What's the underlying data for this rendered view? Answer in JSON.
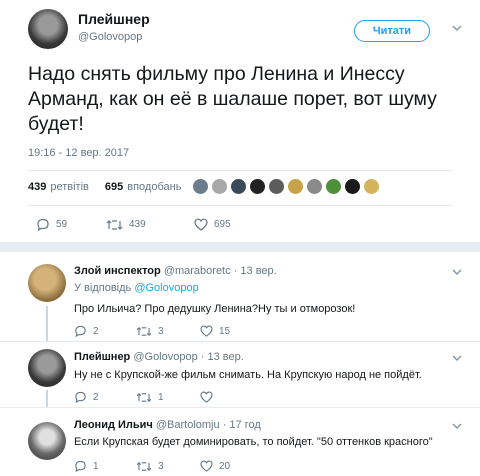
{
  "tweet": {
    "author_name": "Плейшнер",
    "author_handle": "@Golovopop",
    "follow_label": "Читати",
    "text": "Надо снять фильму про Ленина и Инессу Арманд, как он её в шалаше порет, вот шуму будет!",
    "timestamp": "19:16 - 12 вер. 2017",
    "retweets_count": "439",
    "retweets_label": "ретвітів",
    "likes_count": "695",
    "likes_label": "вподобань",
    "actions": {
      "reply": "59",
      "retweet": "439",
      "like": "695"
    }
  },
  "replies": [
    {
      "name": "Злой инспектор",
      "handle": "@maraboretc",
      "time": "· 13 вер.",
      "replying_label": "У відповідь",
      "replying_to": "@Golovopop",
      "text": "Про Ильича? Про дедушку Ленина?Ну ты и отморозок!",
      "actions": {
        "reply": "2",
        "retweet": "3",
        "like": "15"
      }
    },
    {
      "name": "Плейшнер",
      "handle": "@Golovopop",
      "time": "· 13 вер.",
      "text": "Ну не с Крупской-же фильм снимать. На Крупскую народ не пойдёт.",
      "actions": {
        "reply": "2",
        "retweet": "1",
        "like": ""
      }
    },
    {
      "name": "Леонид Ильич",
      "handle": "@Bartolomju",
      "time": "· 17 год",
      "text": "Если Крупская будет доминировать, то пойдет. \"50 оттенков красного\"",
      "actions": {
        "reply": "1",
        "retweet": "3",
        "like": "20"
      }
    }
  ],
  "colors": {
    "accent": "#1da1f2",
    "muted": "#657786",
    "text": "#14171a",
    "divider": "#e6ecf0"
  },
  "icons": [
    "reply-icon",
    "retweet-icon",
    "like-icon",
    "chevron-down-icon"
  ]
}
